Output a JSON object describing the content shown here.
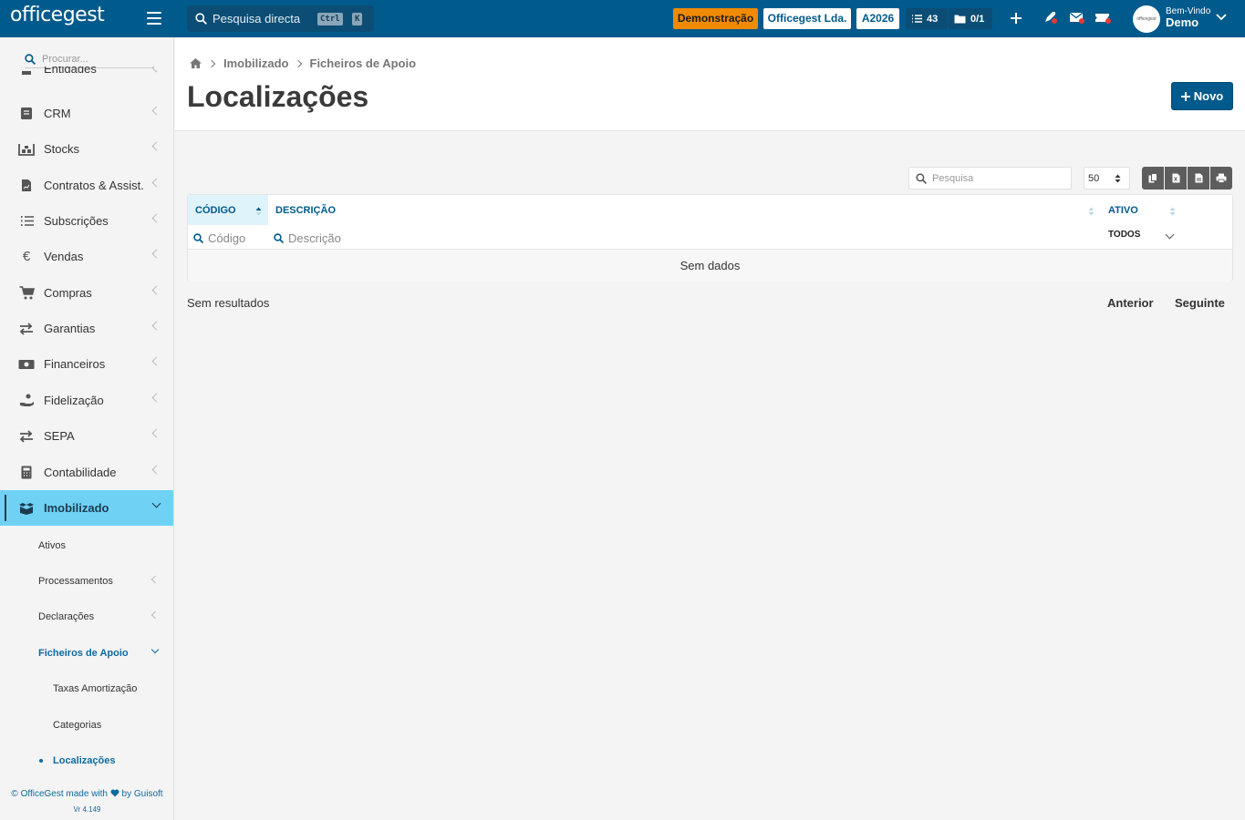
{
  "topbar": {
    "logo": "officegest",
    "search_placeholder": "Pesquisa directa",
    "shortcut_ctrl": "Ctrl",
    "shortcut_key": "K",
    "demo_label": "Demonstração",
    "company_label": "Officegest Lda.",
    "year_label": "A2026",
    "tasks_count": "43",
    "docs_count": "0/1",
    "welcome_small": "Bem-Vindo",
    "welcome_name": "Demo",
    "avatar_text": "officegest",
    "accent_color": "#005a8c",
    "demo_color": "#f08a00"
  },
  "sidebar": {
    "search_placeholder": "Procurar...",
    "partial_item": "Entidades",
    "items": [
      {
        "label": "CRM",
        "icon": "crm-icon"
      },
      {
        "label": "Stocks",
        "icon": "stocks-icon"
      },
      {
        "label": "Contratos & Assist.",
        "icon": "contract-icon"
      },
      {
        "label": "Subscrições",
        "icon": "list-icon"
      },
      {
        "label": "Vendas",
        "icon": "euro-icon"
      },
      {
        "label": "Compras",
        "icon": "cart-icon"
      },
      {
        "label": "Garantias",
        "icon": "exchange-icon"
      },
      {
        "label": "Financeiros",
        "icon": "money-icon"
      },
      {
        "label": "Fidelização",
        "icon": "hand-coin-icon"
      },
      {
        "label": "SEPA",
        "icon": "exchange-icon"
      },
      {
        "label": "Contabilidade",
        "icon": "calculator-icon"
      },
      {
        "label": "Imobilizado",
        "icon": "boxes-icon"
      }
    ],
    "sub_items": {
      "ativos": "Ativos",
      "processamentos": "Processamentos",
      "declaracoes": "Declarações",
      "ficheiros": "Ficheiros de Apoio",
      "taxas": "Taxas Amortização",
      "categorias": "Categorias",
      "localizacoes": "Localizações"
    },
    "footer_prefix": "© OfficeGest made with",
    "footer_suffix": "by Guisoft",
    "version": "Vr 4.149"
  },
  "header": {
    "breadcrumb_1": "Imobilizado",
    "breadcrumb_2": "Ficheiros de Apoio",
    "title": "Localizações",
    "new_button": "Novo"
  },
  "table": {
    "search_placeholder": "Pesquisa",
    "page_size": "50",
    "columns": {
      "codigo": "CÓDIGO",
      "descricao": "DESCRIÇÃO",
      "ativo": "ATIVO"
    },
    "filters": {
      "codigo_placeholder": "Código",
      "descricao_placeholder": "Descrição",
      "ativo_value": "TODOS"
    },
    "empty_text": "Sem dados",
    "results_text": "Sem resultados",
    "prev_label": "Anterior",
    "next_label": "Seguinte"
  }
}
